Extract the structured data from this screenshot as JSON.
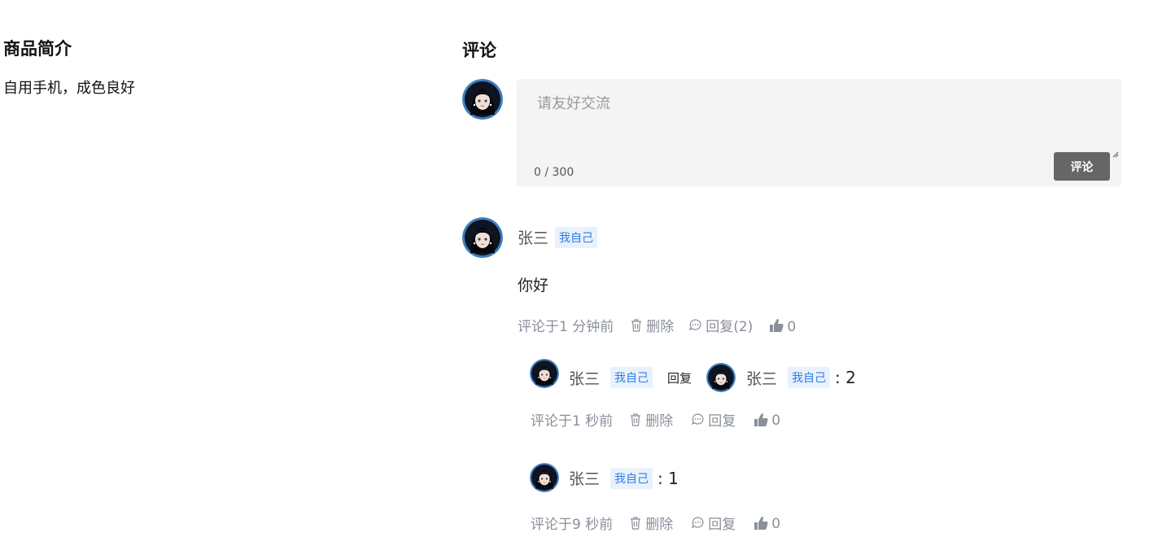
{
  "product": {
    "title": "商品简介",
    "description": "自用手机，成色良好"
  },
  "comments": {
    "title": "评论",
    "composer": {
      "placeholder": "请友好交流",
      "counter": "0 / 300",
      "submit_label": "评论"
    },
    "main": {
      "user": "张三",
      "tag": "我自己",
      "content": "你好",
      "time": "评论于1 分钟前",
      "delete_label": "删除",
      "reply_label": "回复(2)",
      "likes": "0"
    },
    "replies": [
      {
        "user": "张三",
        "tag": "我自己",
        "reply_word": "回复",
        "target_user": "张三",
        "target_tag": "我自己",
        "content": ": 2",
        "time": "评论于1 秒前",
        "delete_label": "删除",
        "reply_label": "回复",
        "likes": "0"
      },
      {
        "user": "张三",
        "tag": "我自己",
        "content": ": 1",
        "time": "评论于9 秒前",
        "delete_label": "删除",
        "reply_label": "回复",
        "likes": "0"
      }
    ]
  },
  "colors": {
    "tag_bg": "#e8f1fc",
    "tag_text": "#2f7de1",
    "button_bg": "#666666",
    "muted": "#8a8f99"
  }
}
